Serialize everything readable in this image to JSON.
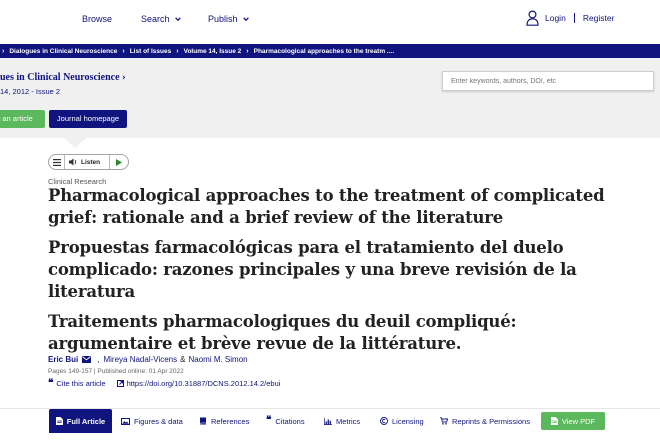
{
  "header": {
    "nav": [
      {
        "label": "Browse"
      },
      {
        "label": "Search"
      },
      {
        "label": "Publish"
      }
    ],
    "login_label": "Login",
    "register_label": "Register"
  },
  "breadcrumb": [
    "Dialogues in Clinical Neuroscience",
    "List of Issues",
    "Volume 14, Issue 2",
    "Pharmacological approaches to the treatm ...."
  ],
  "journal": {
    "title": "ues in Clinical Neuroscience",
    "issue_line": "14, 2012 - Issue 2",
    "submit_label": "t an article",
    "homepage_label": "Journal homepage",
    "search_placeholder": "Enter keywords, authors, DOI, etc"
  },
  "article": {
    "listen_label": "Listen",
    "category": "Clinical Research",
    "title_en": "Pharmacological approaches to the treatment of complicated grief: rationale and a brief review of the literature",
    "title_es": "Propuestas farmacológicas para el tratamiento del duelo complicado: razones principales y una breve revisión de la literatura",
    "title_fr": "Traitements pharmacologiques du deuil compliqué: argumentaire et brève revue de la littérature.",
    "authors": {
      "first": "Eric Bui",
      "second": "Mireya Nadal-Vicens",
      "joiner": "&",
      "third": "Naomi M. Simon"
    },
    "pages_info": "Pages 149-157 | Published online: 01 Apr 2022",
    "cite_label": "Cite this article",
    "doi": "https://doi.org/10.31887/DCNS.2012.14.2/ebui"
  },
  "tabs": [
    {
      "label": "Full Article"
    },
    {
      "label": "Figures & data"
    },
    {
      "label": "References"
    },
    {
      "label": "Citations"
    },
    {
      "label": "Metrics"
    },
    {
      "label": "Licensing"
    },
    {
      "label": "Reprints & Permissions"
    },
    {
      "label": "View PDF"
    }
  ],
  "colors": {
    "brand": "#10147e",
    "green": "#5cb85c",
    "band": "#f0f0f0"
  }
}
